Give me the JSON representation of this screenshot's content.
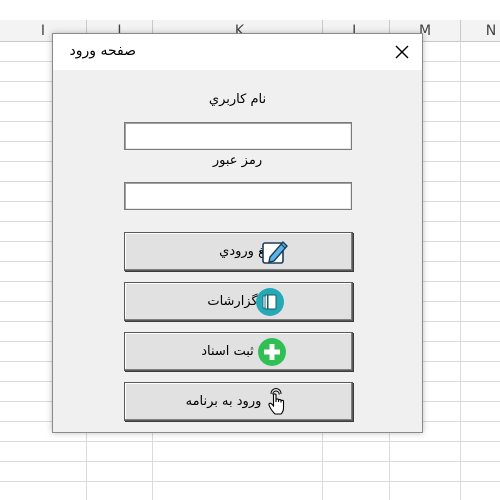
{
  "sheet": {
    "column_headers": [
      "I",
      "J",
      "K",
      "L",
      "M",
      "N"
    ]
  },
  "dialog": {
    "title": "صفحه ورود",
    "close_icon": "close-icon",
    "username_label": "نام کاربري",
    "username_value": "",
    "password_label": "رمز عبور",
    "password_value": "",
    "buttons": [
      {
        "label": "مبالغ ورودي",
        "icon": "edit-pencil-icon"
      },
      {
        "label": "گزارشات",
        "icon": "report-book-icon"
      },
      {
        "label": "ثبت اسناد",
        "icon": "add-plus-icon"
      },
      {
        "label": "ورود به برنامه",
        "icon": "hand-pointer-icon"
      }
    ]
  }
}
